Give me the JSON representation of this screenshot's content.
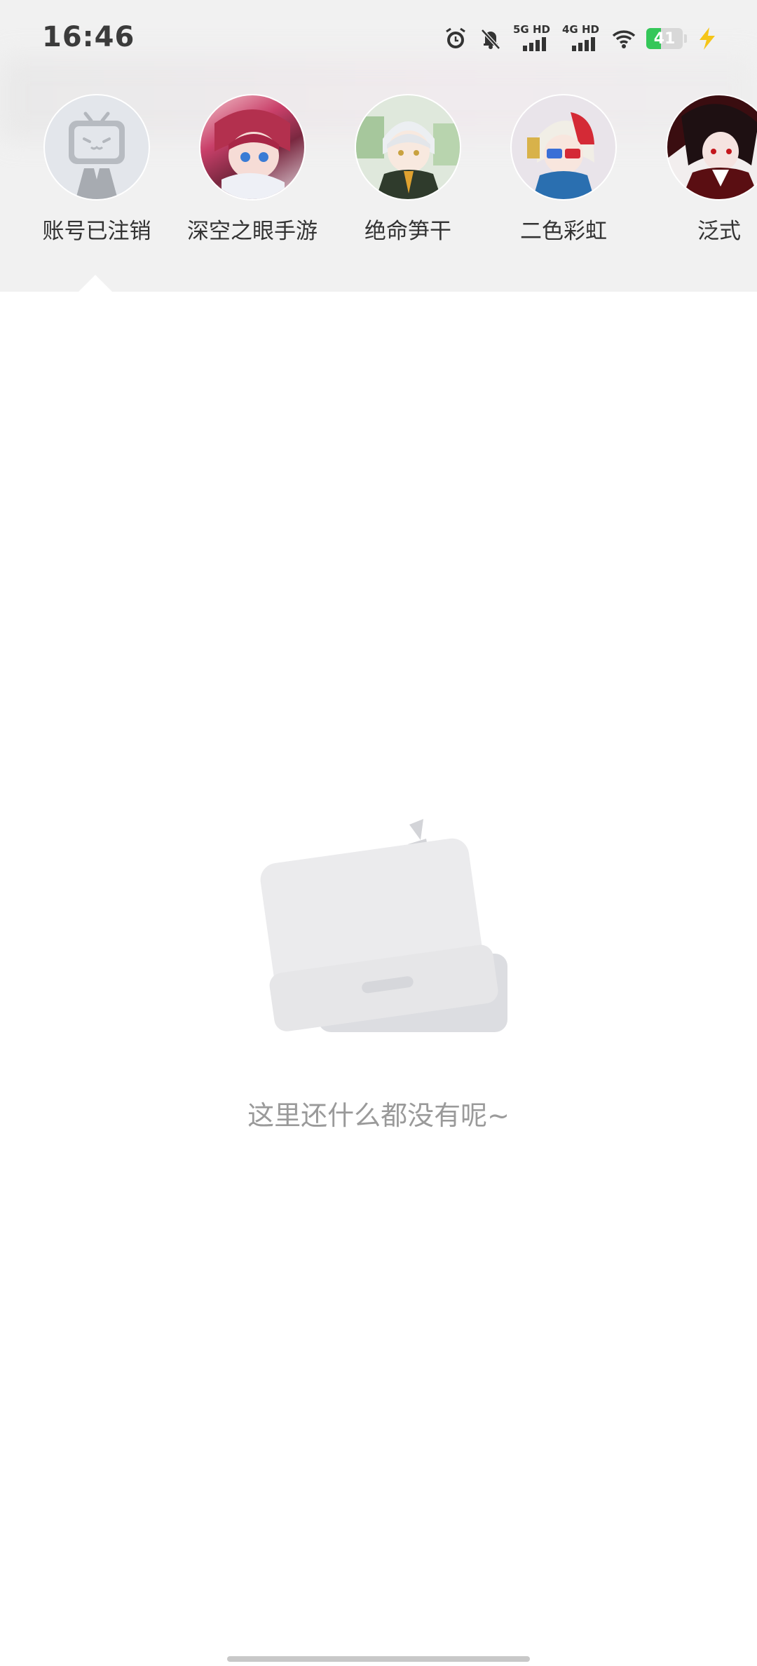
{
  "status_bar": {
    "time": "16:46",
    "network_1": "5G HD",
    "network_2": "4G HD",
    "battery": "41",
    "battery_color": "#34c759",
    "charging_color": "#f5c518"
  },
  "following_ups": [
    {
      "name": "账号已注销",
      "avatar": "bilibili-tv-default-avatar",
      "selected": true
    },
    {
      "name": "深空之眼手游",
      "avatar": "anime-girl-red-hair-avatar"
    },
    {
      "name": "绝命笋干",
      "avatar": "anime-boy-white-hair-avatar"
    },
    {
      "name": "二色彩虹",
      "avatar": "anime-girl-3d-glasses-avatar"
    },
    {
      "name": "泛式",
      "avatar": "anime-dark-red-avatar"
    }
  ],
  "empty_state": {
    "message": "这里还什么都没有呢~",
    "illustration": "empty-tv-icon"
  }
}
